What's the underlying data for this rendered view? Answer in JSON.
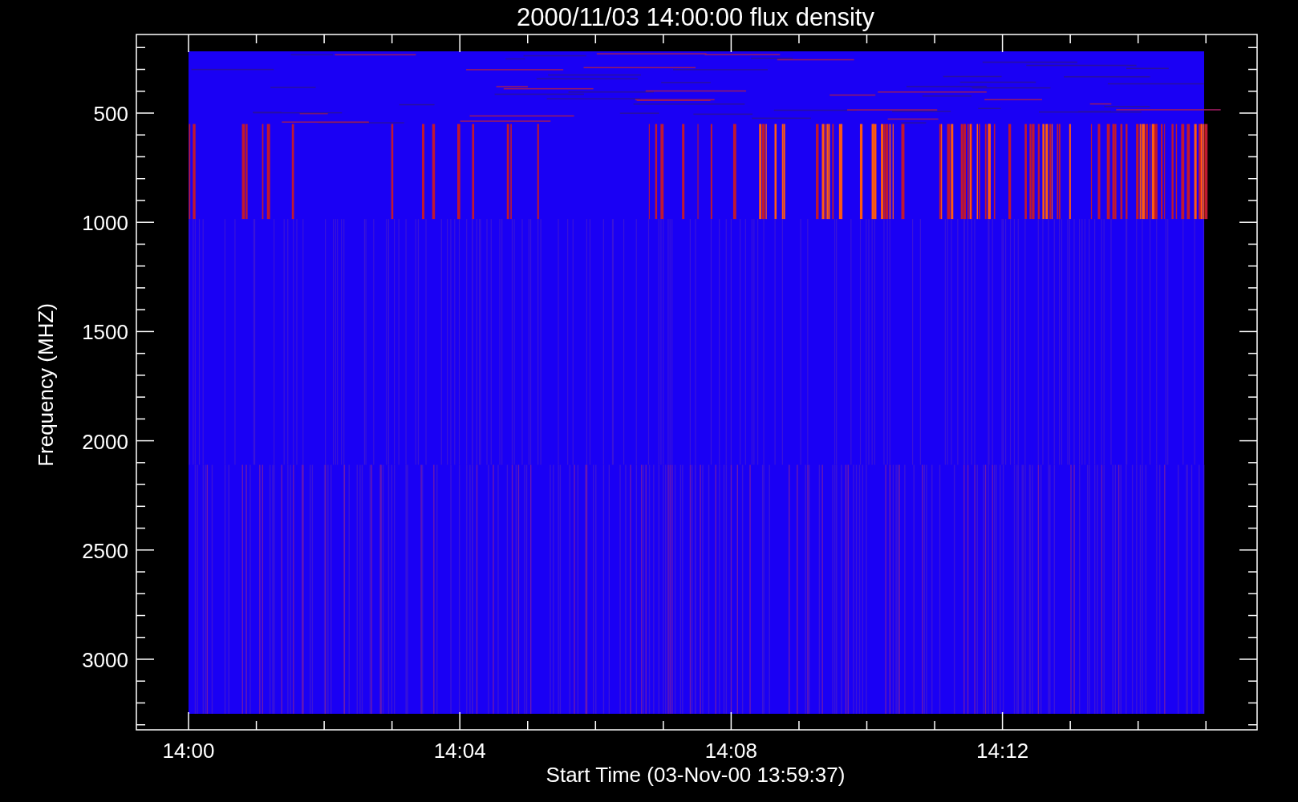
{
  "plot": {
    "title": "2000/11/03 14:00:00 flux density",
    "y_axis": {
      "label": "Frequency (MHZ)",
      "ticks": [
        "500",
        "1000",
        "1500",
        "2000",
        "2500",
        "3000"
      ]
    },
    "x_axis": {
      "label": "Start Time (03-Nov-00 13:59:37)",
      "ticks": [
        "14:00",
        "14:04",
        "14:08",
        "14:12"
      ]
    }
  }
}
